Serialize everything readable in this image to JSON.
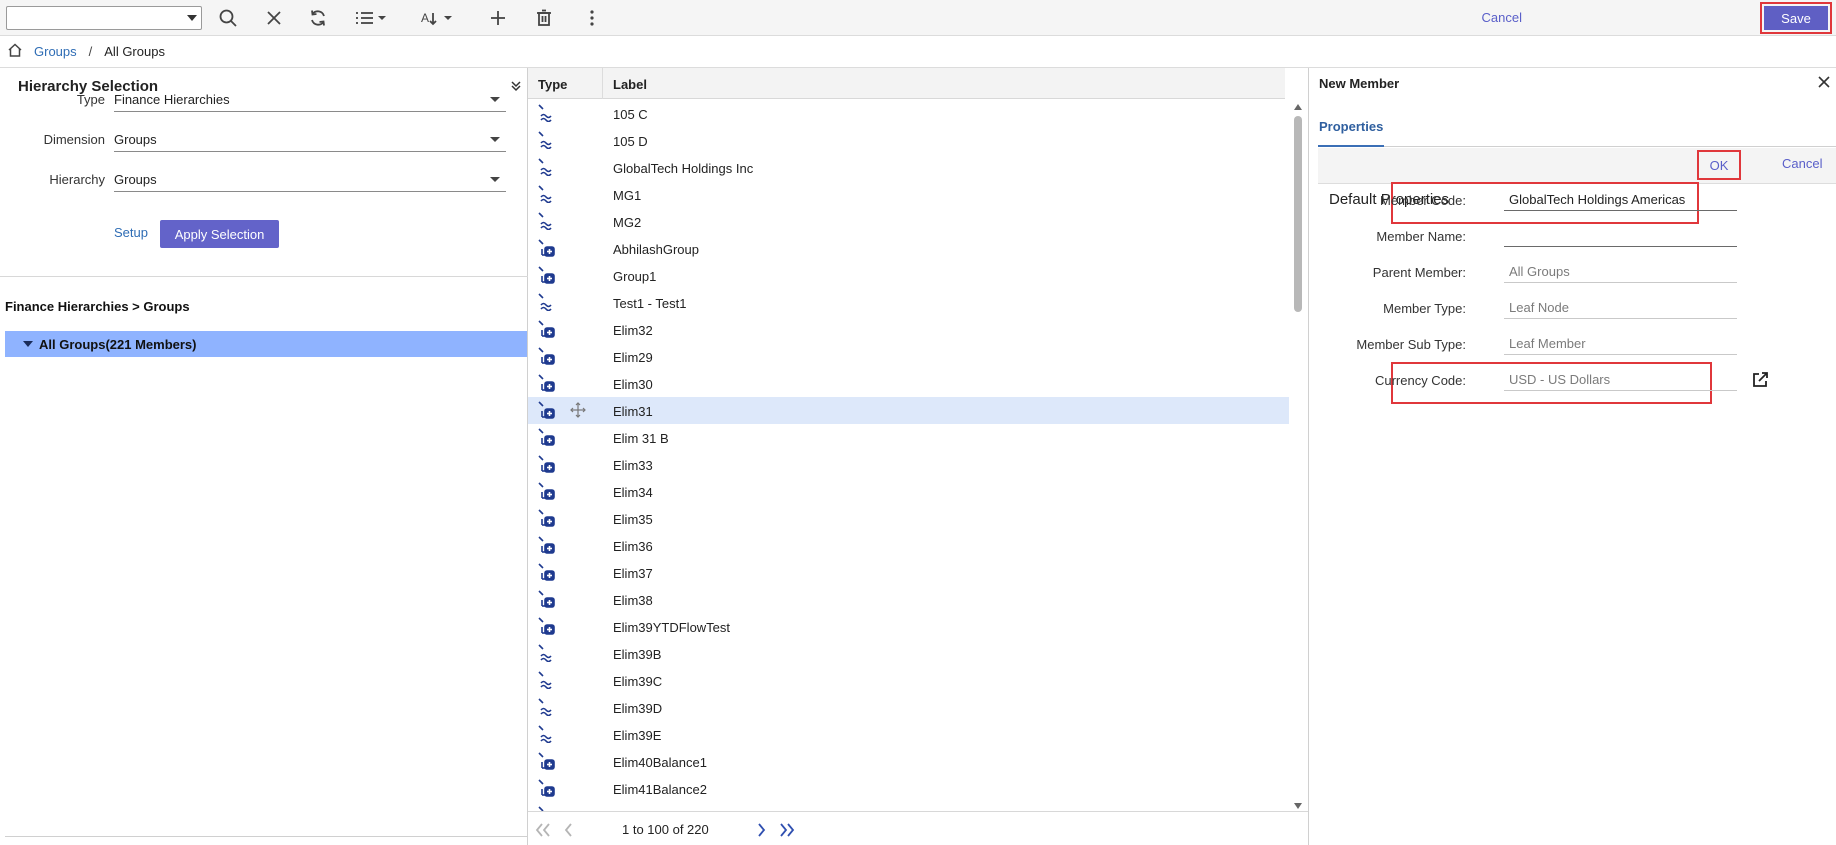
{
  "toolbar": {
    "select_value": "",
    "icons": [
      "search-icon",
      "close-icon",
      "refresh-icon",
      "list-view-icon",
      "sort-icon",
      "add-icon",
      "delete-icon",
      "more-icon"
    ],
    "cancel_label": "Cancel",
    "save_label": "Save",
    "save_color": "#5f5fc4"
  },
  "breadcrumb": {
    "link": "Groups",
    "separator": "/",
    "current": "All Groups"
  },
  "hierarchy_selection": {
    "title": "Hierarchy Selection",
    "fields": [
      {
        "label": "Type",
        "value": "Finance Hierarchies"
      },
      {
        "label": "Dimension",
        "value": "Groups"
      },
      {
        "label": "Hierarchy",
        "value": "Groups"
      }
    ],
    "setup_label": "Setup",
    "apply_label": "Apply Selection"
  },
  "tree": {
    "title": "Finance Hierarchies > Groups",
    "root": "All Groups(221 Members)",
    "root_color": "#8fb3ff"
  },
  "grid": {
    "columns": [
      "Type",
      "Label"
    ],
    "rows": [
      {
        "type": "wave",
        "label": "105 C"
      },
      {
        "type": "wave",
        "label": "105 D"
      },
      {
        "type": "wave",
        "label": "GlobalTech Holdings Inc"
      },
      {
        "type": "wave",
        "label": "MG1"
      },
      {
        "type": "wave",
        "label": "MG2"
      },
      {
        "type": "plus",
        "label": "AbhilashGroup"
      },
      {
        "type": "plus",
        "label": "Group1"
      },
      {
        "type": "wave",
        "label": "Test1 - Test1"
      },
      {
        "type": "plus",
        "label": "Elim32"
      },
      {
        "type": "plus",
        "label": "Elim29"
      },
      {
        "type": "plus",
        "label": "Elim30"
      },
      {
        "type": "plus",
        "label": "Elim31",
        "selected": true
      },
      {
        "type": "plus",
        "label": "Elim 31 B"
      },
      {
        "type": "plus",
        "label": "Elim33"
      },
      {
        "type": "plus",
        "label": "Elim34"
      },
      {
        "type": "plus",
        "label": "Elim35"
      },
      {
        "type": "plus",
        "label": "Elim36"
      },
      {
        "type": "plus",
        "label": "Elim37"
      },
      {
        "type": "plus",
        "label": "Elim38"
      },
      {
        "type": "plus",
        "label": "Elim39YTDFlowTest"
      },
      {
        "type": "wave",
        "label": "Elim39B"
      },
      {
        "type": "wave",
        "label": "Elim39C"
      },
      {
        "type": "wave",
        "label": "Elim39D"
      },
      {
        "type": "wave",
        "label": "Elim39E"
      },
      {
        "type": "plus",
        "label": "Elim40Balance1"
      },
      {
        "type": "plus",
        "label": "Elim41Balance2"
      },
      {
        "type": "plus",
        "label": ""
      }
    ],
    "pager_text": "1 to 100 of 220"
  },
  "new_member": {
    "title": "New Member",
    "tab": "Properties",
    "ok_label": "OK",
    "cancel_label": "Cancel",
    "section_title": "Default Properties",
    "properties": [
      {
        "label": "Member Code:",
        "value": "GlobalTech Holdings Americas",
        "kind": "editable",
        "highlight": true
      },
      {
        "label": "Member Name:",
        "value": "",
        "kind": "editable"
      },
      {
        "label": "Parent Member:",
        "value": "All Groups",
        "kind": "readonly"
      },
      {
        "label": "Member Type:",
        "value": "Leaf Node",
        "kind": "readonly"
      },
      {
        "label": "Member Sub Type:",
        "value": "Leaf Member",
        "kind": "readonly"
      },
      {
        "label": "Currency Code:",
        "value": "USD - US Dollars",
        "kind": "readonly",
        "highlight": true,
        "external_link": true
      }
    ],
    "highlight_color": "#e0373b"
  }
}
